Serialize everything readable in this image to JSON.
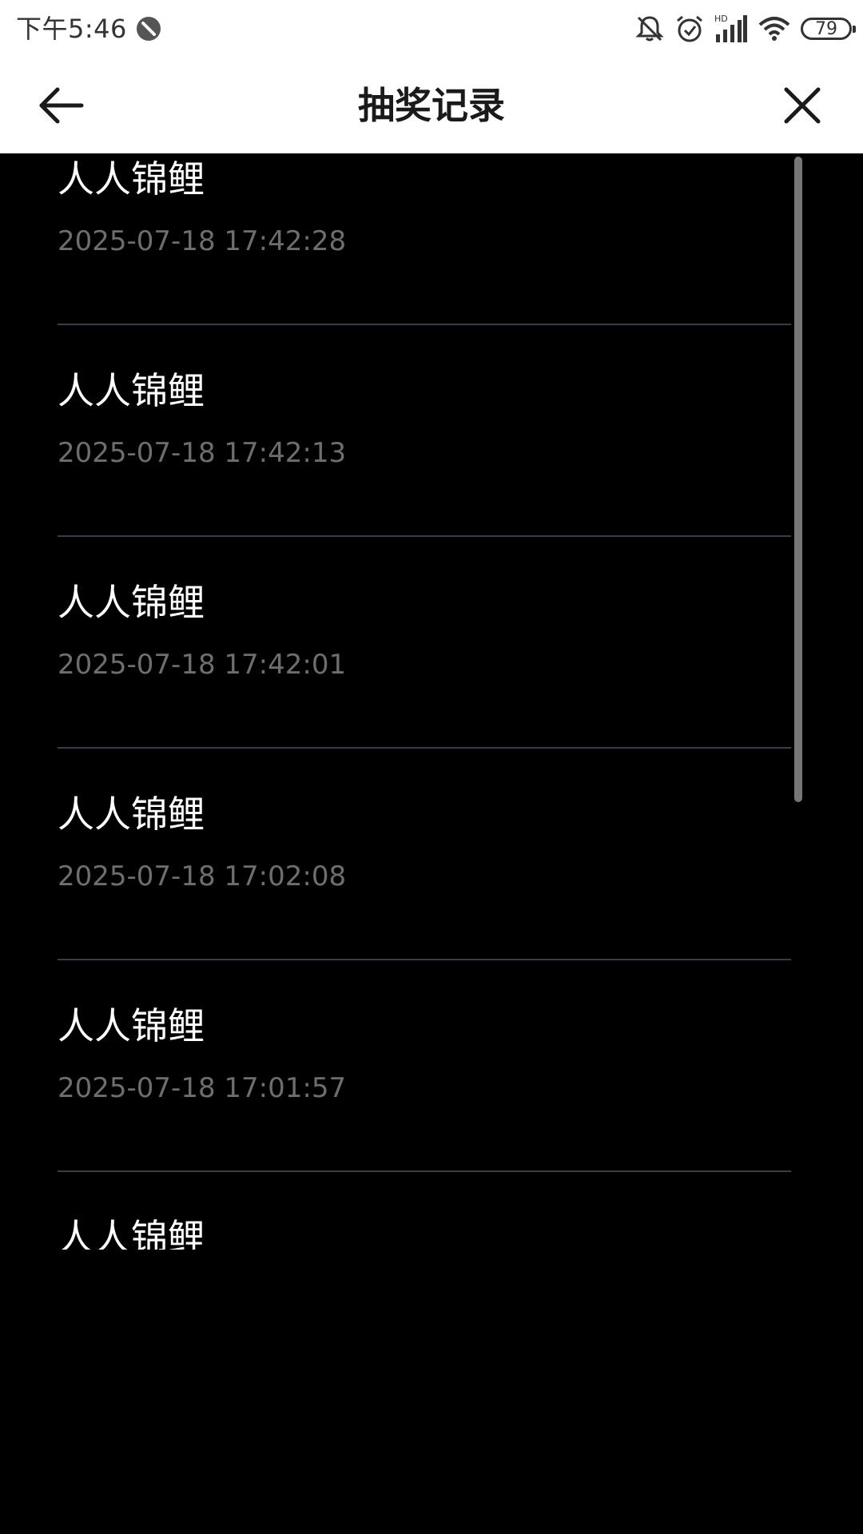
{
  "status_bar": {
    "time": "下午5:46",
    "battery_level": "79",
    "network_label": "HD",
    "icons": [
      "dnd-icon",
      "bell-muted-icon",
      "alarm-icon",
      "signal-icon",
      "wifi-icon",
      "battery-icon"
    ]
  },
  "nav": {
    "title": "抽奖记录",
    "back_icon": "arrow-left-icon",
    "close_icon": "close-icon"
  },
  "records": [
    {
      "name": "人人锦鲤",
      "time": "2025-07-18 17:42:28"
    },
    {
      "name": "人人锦鲤",
      "time": "2025-07-18 17:42:13"
    },
    {
      "name": "人人锦鲤",
      "time": "2025-07-18 17:42:01"
    },
    {
      "name": "人人锦鲤",
      "time": "2025-07-18 17:02:08"
    },
    {
      "name": "人人锦鲤",
      "time": "2025-07-18 17:01:57"
    },
    {
      "name": "人人锦鲤",
      "time": ""
    }
  ],
  "colors": {
    "background": "#000000",
    "header_bg": "#ffffff",
    "divider": "#3a3d45",
    "timestamp": "#6e6e6e",
    "scrollbar": "#777777"
  }
}
